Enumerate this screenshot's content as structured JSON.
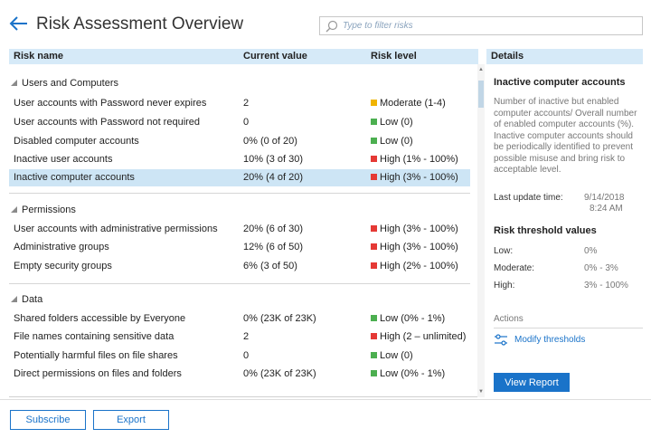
{
  "header": {
    "title": "Risk Assessment Overview",
    "filter_placeholder": "Type to filter risks"
  },
  "table": {
    "columns": [
      "Risk name",
      "Current value",
      "Risk level"
    ],
    "groups": [
      {
        "name": "Users and Computers",
        "rows": [
          {
            "name": "User accounts with Password never expires",
            "value": "2",
            "level": "Moderate (1-4)",
            "color": "#f0b400"
          },
          {
            "name": "User accounts with Password not required",
            "value": "0",
            "level": "Low (0)",
            "color": "#4caf50"
          },
          {
            "name": "Disabled computer accounts",
            "value": "0% (0 of 20)",
            "level": "Low (0)",
            "color": "#4caf50"
          },
          {
            "name": "Inactive user accounts",
            "value": "10% (3 of 30)",
            "level": "High (1% - 100%)",
            "color": "#e53935"
          },
          {
            "name": "Inactive computer accounts",
            "value": "20% (4 of 20)",
            "level": "High (3% - 100%)",
            "color": "#e53935",
            "selected": true
          }
        ]
      },
      {
        "name": "Permissions",
        "rows": [
          {
            "name": "User accounts with administrative permissions",
            "value": "20% (6 of 30)",
            "level": "High (3% - 100%)",
            "color": "#e53935"
          },
          {
            "name": "Administrative groups",
            "value": "12% (6 of 50)",
            "level": "High (3% - 100%)",
            "color": "#e53935"
          },
          {
            "name": "Empty security groups",
            "value": "6% (3 of 50)",
            "level": "High (2% - 100%)",
            "color": "#e53935"
          }
        ]
      },
      {
        "name": "Data",
        "rows": [
          {
            "name": "Shared folders accessible by Everyone",
            "value": "0% (23K of 23K)",
            "level": "Low (0% - 1%)",
            "color": "#4caf50"
          },
          {
            "name": "File names containing sensitive data",
            "value": "2",
            "level": "High (2 – unlimited)",
            "color": "#e53935"
          },
          {
            "name": "Potentially harmful files on file shares",
            "value": "0",
            "level": "Low (0)",
            "color": "#4caf50"
          },
          {
            "name": "Direct permissions on files and folders",
            "value": "0% (23K of 23K)",
            "level": "Low (0% - 1%)",
            "color": "#4caf50"
          }
        ]
      }
    ]
  },
  "details": {
    "heading": "Details",
    "title": "Inactive computer accounts",
    "description": "Number of inactive but enabled computer accounts/ Overall number of enabled computer accounts (%). Inactive computer accounts should be periodically identified to prevent possible misuse and bring risk to acceptable level.",
    "last_update_label": "Last update time:",
    "last_update_date": "9/14/2018",
    "last_update_time": "8:24 AM",
    "thresholds_title": "Risk threshold values",
    "thresholds": [
      {
        "label": "Low:",
        "value": "0%"
      },
      {
        "label": "Moderate:",
        "value": "0% - 3%"
      },
      {
        "label": "High:",
        "value": "3% - 100%"
      }
    ],
    "actions_label": "Actions",
    "modify_label": "Modify thresholds",
    "view_report_label": "View Report"
  },
  "footer": {
    "subscribe_label": "Subscribe",
    "export_label": "Export"
  }
}
